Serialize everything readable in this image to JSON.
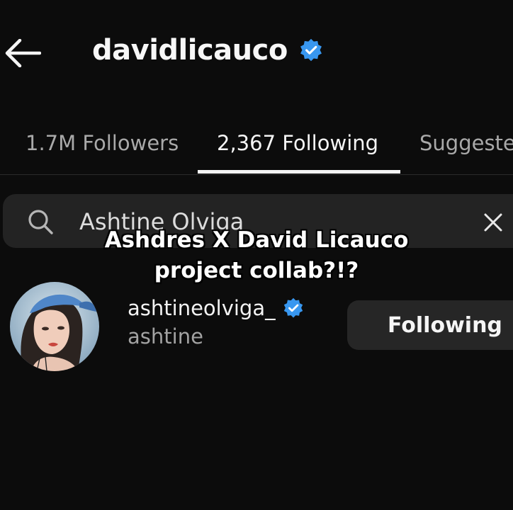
{
  "header": {
    "title": "davidlicauco",
    "back_icon": "arrow-left-icon",
    "verified_icon": "verified-badge-icon"
  },
  "tabs": [
    {
      "label": "1.7M Followers",
      "active": false
    },
    {
      "label": "2,367 Following",
      "active": true
    },
    {
      "label": "Suggested",
      "active": false
    }
  ],
  "search": {
    "value": "Ashtine Olviga",
    "search_icon": "search-icon",
    "clear_icon": "close-icon"
  },
  "caption": {
    "line1": "Ashdres X David Licauco",
    "line2": "project collab?!?"
  },
  "result": {
    "username": "ashtineolviga_",
    "fullname": "ashtine",
    "button_label": "Following",
    "verified_icon": "verified-badge-icon"
  },
  "colors": {
    "background": "#0c0c0c",
    "verified_blue": "#3897f0",
    "search_bg": "#232323",
    "button_bg": "#262626"
  }
}
